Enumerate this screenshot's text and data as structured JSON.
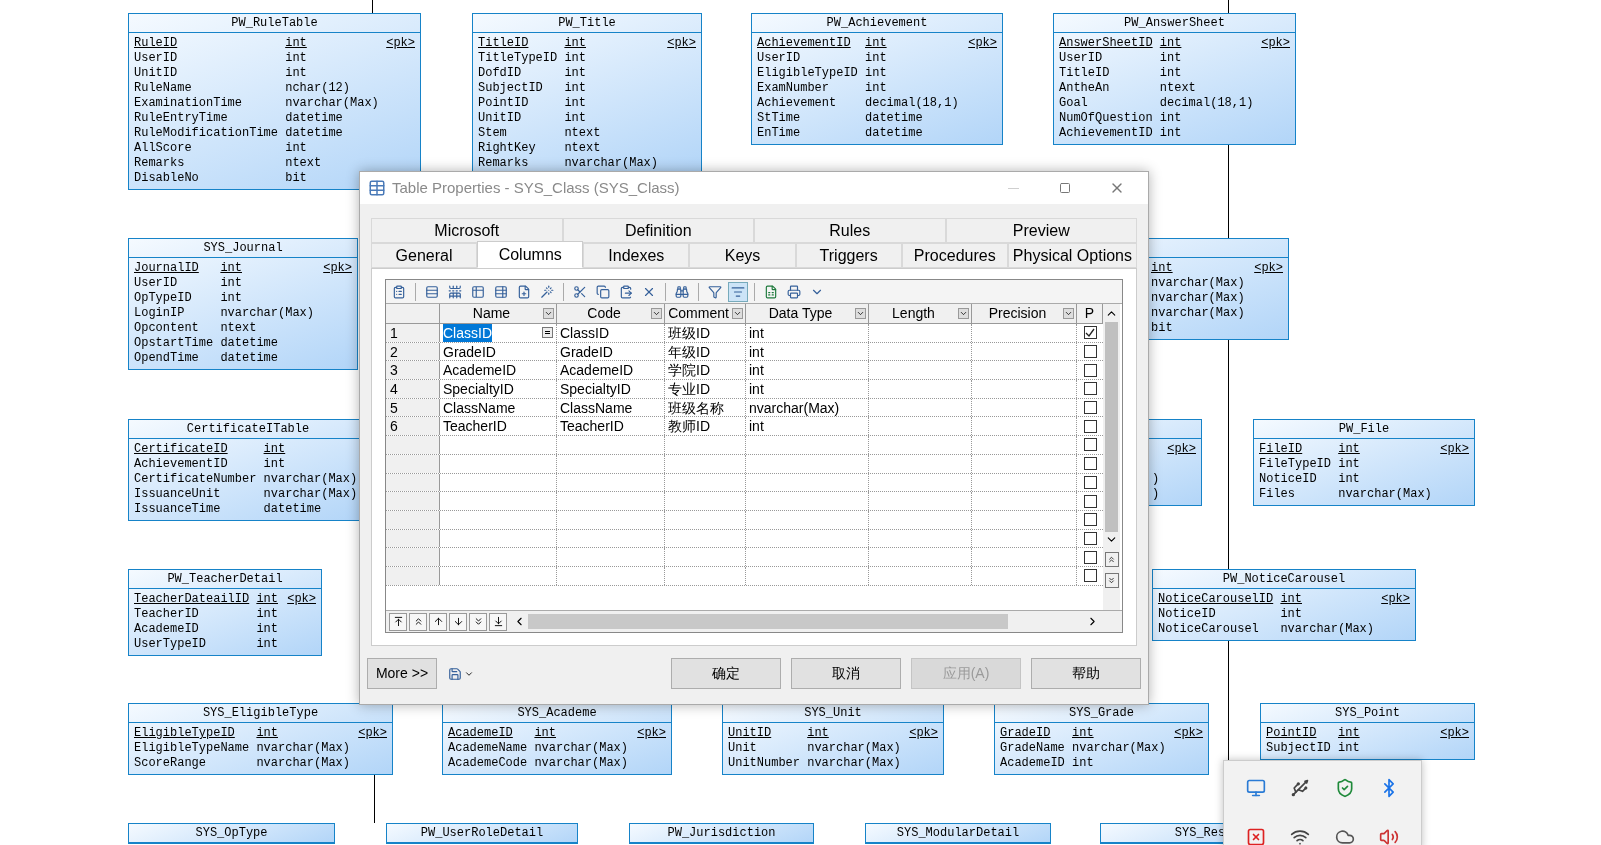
{
  "diagram": {
    "entities": [
      {
        "title": "PW_RuleTable",
        "columns": [
          {
            "name": "RuleID",
            "type": "int",
            "marker": "<pk>",
            "primary_key": true
          },
          {
            "name": "UserID",
            "type": "int",
            "primary_key": false
          },
          {
            "name": "UnitID",
            "type": "int",
            "primary_key": false
          },
          {
            "name": "RuleName",
            "type": "nchar(12)",
            "primary_key": false
          },
          {
            "name": "ExaminationTime",
            "type": "nvarchar(Max)",
            "primary_key": false
          },
          {
            "name": "RuleEntryTime",
            "type": "datetime",
            "primary_key": false
          },
          {
            "name": "RuleModificationTime",
            "type": "datetime",
            "primary_key": false
          },
          {
            "name": "AllScore",
            "type": "int",
            "primary_key": false
          },
          {
            "name": "Remarks",
            "type": "ntext",
            "primary_key": false
          },
          {
            "name": "DisableNo",
            "type": "bit",
            "primary_key": false
          }
        ]
      },
      {
        "title": "PW_Title",
        "columns": [
          {
            "name": "TitleID",
            "type": "int",
            "marker": "<pk>",
            "primary_key": true
          },
          {
            "name": "TitleTypeID",
            "type": "int",
            "primary_key": false
          },
          {
            "name": "DofdID",
            "type": "int",
            "primary_key": false
          },
          {
            "name": "SubjectID",
            "type": "int",
            "primary_key": false
          },
          {
            "name": "PointID",
            "type": "int",
            "primary_key": false
          },
          {
            "name": "UnitID",
            "type": "int",
            "primary_key": false
          },
          {
            "name": "Stem",
            "type": "ntext",
            "primary_key": false
          },
          {
            "name": "RightKey",
            "type": "ntext",
            "primary_key": false
          },
          {
            "name": "Remarks",
            "type": "nvarchar(Max)",
            "primary_key": false
          }
        ]
      },
      {
        "title": "PW_Achievement",
        "columns": [
          {
            "name": "AchievementID",
            "type": "int",
            "marker": "<pk>",
            "primary_key": true
          },
          {
            "name": "UserID",
            "type": "int",
            "primary_key": false
          },
          {
            "name": "EligibleTypeID",
            "type": "int",
            "primary_key": false
          },
          {
            "name": "ExamNumber",
            "type": "int",
            "primary_key": false
          },
          {
            "name": "Achievement",
            "type": "decimal(18,1)",
            "primary_key": false
          },
          {
            "name": "StTime",
            "type": "datetime",
            "primary_key": false
          },
          {
            "name": "EnTime",
            "type": "datetime",
            "primary_key": false
          }
        ]
      },
      {
        "title": "PW_AnswerSheet",
        "columns": [
          {
            "name": "AnswerSheetID",
            "type": "int",
            "marker": "<pk>",
            "primary_key": true
          },
          {
            "name": "UserID",
            "type": "int",
            "primary_key": false
          },
          {
            "name": "TitleID",
            "type": "int",
            "primary_key": false
          },
          {
            "name": "AntheAn",
            "type": "ntext",
            "primary_key": false
          },
          {
            "name": "Goal",
            "type": "decimal(18,1)",
            "primary_key": false
          },
          {
            "name": "NumOfQuestion",
            "type": "int",
            "primary_key": false
          },
          {
            "name": "AchievementID",
            "type": "int",
            "primary_key": false
          }
        ]
      },
      {
        "title": "SYS_Journal",
        "columns": [
          {
            "name": "JournalID",
            "type": "int",
            "marker": "<pk>",
            "primary_key": true
          },
          {
            "name": "UserID",
            "type": "int",
            "primary_key": false
          },
          {
            "name": "OpTypeID",
            "type": "int",
            "primary_key": false
          },
          {
            "name": "LoginIP",
            "type": "nvarchar(Max)",
            "primary_key": false
          },
          {
            "name": "Opcontent",
            "type": "ntext",
            "primary_key": false
          },
          {
            "name": "OpstartTime",
            "type": "datetime",
            "primary_key": false
          },
          {
            "name": "OpendTime",
            "type": "datetime",
            "primary_key": false
          }
        ]
      },
      {
        "columns": [
          {
            "type": "int",
            "marker": "<pk>",
            "primary_key": true
          },
          {
            "type": "nvarchar(Max)",
            "primary_key": false
          },
          {
            "type": "nvarchar(Max)",
            "primary_key": false
          },
          {
            "type": "nvarchar(Max)",
            "primary_key": false
          },
          {
            "type": "bit",
            "primary_key": false
          }
        ]
      },
      {
        "title": "CertificateITable",
        "columns": [
          {
            "name": "CertificateID",
            "type": "int",
            "primary_key": true
          },
          {
            "name": "AchievementID",
            "type": "int",
            "primary_key": false
          },
          {
            "name": "CertificateNumber",
            "type": "nvarchar(Max)",
            "primary_key": false
          },
          {
            "name": "IssuanceUnit",
            "type": "nvarchar(Max)",
            "primary_key": false
          },
          {
            "name": "IssuanceTime",
            "type": "datetime",
            "primary_key": false
          }
        ]
      },
      {
        "columns": [
          {
            "marker": "<pk>",
            "kind": "column"
          },
          {
            "type": ")",
            "kind": "spaced"
          },
          {
            "type": ")",
            "kind": "column"
          }
        ]
      },
      {
        "title": "PW_File",
        "columns": [
          {
            "name": "FileID",
            "type": "int",
            "marker": "<pk>",
            "primary_key": true
          },
          {
            "name": "FileTypeID",
            "type": "int",
            "primary_key": false
          },
          {
            "name": "NoticeID",
            "type": "int",
            "primary_key": false
          },
          {
            "name": "Files",
            "type": "nvarchar(Max)",
            "primary_key": false
          }
        ]
      },
      {
        "title": "PW_TeacherDetail",
        "columns": [
          {
            "name": "TeacherDateailID",
            "type": "int",
            "marker": "<pk>",
            "primary_key": true
          },
          {
            "name": "TeacherID",
            "type": "int",
            "primary_key": false
          },
          {
            "name": "AcademeID",
            "type": "int",
            "primary_key": false
          },
          {
            "name": "UserTypeID",
            "type": "int",
            "primary_key": false
          }
        ]
      },
      {
        "title": "PW_NoticeCarousel",
        "columns": [
          {
            "name": "NoticeCarouselID",
            "type": "int",
            "marker": "<pk>",
            "primary_key": true
          },
          {
            "name": "NoticeID",
            "type": "int",
            "primary_key": false
          },
          {
            "name": "NoticeCarousel",
            "type": "nvarchar(Max)",
            "primary_key": false
          }
        ]
      },
      {
        "title": "SYS_EligibleType",
        "columns": [
          {
            "name": "EligibleTypeID",
            "type": "int",
            "marker": "<pk>",
            "primary_key": true
          },
          {
            "name": "EligibleTypeName",
            "type": "nvarchar(Max)",
            "primary_key": false
          },
          {
            "name": "ScoreRange",
            "type": "nvarchar(Max)",
            "primary_key": false
          }
        ]
      },
      {
        "title": "SYS_Academe",
        "columns": [
          {
            "name": "AcademeID",
            "type": "int",
            "marker": "<pk>",
            "primary_key": true
          },
          {
            "name": "AcademeName",
            "type": "nvarchar(Max)",
            "primary_key": false
          },
          {
            "name": "AcademeCode",
            "type": "nvarchar(Max)",
            "primary_key": false
          }
        ]
      },
      {
        "title": "SYS_Unit",
        "columns": [
          {
            "name": "UnitID",
            "type": "int",
            "marker": "<pk>",
            "primary_key": true
          },
          {
            "name": "Unit",
            "type": "nvarchar(Max)",
            "primary_key": false
          },
          {
            "name": "UnitNumber",
            "type": "nvarchar(Max)",
            "primary_key": false
          }
        ]
      },
      {
        "title": "SYS_Grade",
        "columns": [
          {
            "name": "GradeID",
            "type": "int",
            "marker": "<pk>",
            "primary_key": true
          },
          {
            "name": "GradeName",
            "type": "nvarchar(Max)",
            "primary_key": false
          },
          {
            "name": "AcademeID",
            "type": "int",
            "primary_key": false
          }
        ]
      },
      {
        "title": "SYS_Point",
        "columns": [
          {
            "name": "PointID",
            "type": "int",
            "marker": "<pk>",
            "primary_key": true
          },
          {
            "name": "SubjectID",
            "type": "int",
            "primary_key": false
          }
        ]
      },
      {
        "title": "SYS_OpType"
      },
      {
        "title": "PW_UserRoleDetail"
      },
      {
        "title": "PW_Jurisdiction"
      },
      {
        "title": "SYS_ModularDetail"
      },
      {
        "title": "SYS_Res"
      }
    ]
  },
  "dialog": {
    "title": "Table Properties - SYS_Class (SYS_Class)",
    "tab_rows": [
      [
        {
          "label": "Microsoft",
          "selected": false
        },
        {
          "label": "Definition",
          "selected": false
        },
        {
          "label": "Rules",
          "selected": false
        },
        {
          "label": "Preview",
          "selected": false
        }
      ],
      [
        {
          "label": "General",
          "selected": false
        },
        {
          "label": "Columns",
          "selected": true
        },
        {
          "label": "Indexes",
          "selected": false
        },
        {
          "label": "Keys",
          "selected": false
        },
        {
          "label": "Triggers",
          "selected": false
        },
        {
          "label": "Procedures",
          "selected": false
        },
        {
          "label": "Physical Options",
          "selected": false
        }
      ]
    ],
    "toolbar": [
      {
        "kind": "properties",
        "pressed": false
      },
      {
        "kind": "separator"
      },
      {
        "kind": "insert-row",
        "pressed": false
      },
      {
        "kind": "add-row",
        "pressed": false
      },
      {
        "kind": "add-columns",
        "pressed": false
      },
      {
        "kind": "replicate",
        "pressed": false
      },
      {
        "kind": "new",
        "pressed": false
      },
      {
        "kind": "wand",
        "pressed": false
      },
      {
        "kind": "separator"
      },
      {
        "kind": "cut",
        "pressed": false
      },
      {
        "kind": "copy",
        "pressed": false
      },
      {
        "kind": "paste",
        "pressed": false
      },
      {
        "kind": "delete",
        "pressed": false
      },
      {
        "kind": "separator"
      },
      {
        "kind": "find",
        "pressed": false
      },
      {
        "kind": "separator"
      },
      {
        "kind": "filter",
        "pressed": false
      },
      {
        "kind": "filter-check",
        "pressed": true
      },
      {
        "kind": "separator"
      },
      {
        "kind": "excel",
        "pressed": false
      },
      {
        "kind": "print",
        "pressed": false
      },
      {
        "kind": "dropdown",
        "pressed": false
      }
    ],
    "grid": {
      "columns": [
        "Name",
        "Code",
        "Comment",
        "Data Type",
        "Length",
        "Precision",
        "P"
      ],
      "rows": [
        {
          "number": "1",
          "name": "ClassID",
          "code": "ClassID",
          "comment": "班级ID",
          "data_type": "int",
          "primary": true,
          "editing": true
        },
        {
          "number": "2",
          "name": "GradeID",
          "code": "GradeID",
          "comment": "年级ID",
          "data_type": "int",
          "primary": false,
          "editing": false
        },
        {
          "number": "3",
          "name": "AcademeID",
          "code": "AcademeID",
          "comment": "学院ID",
          "data_type": "int",
          "primary": false,
          "editing": false
        },
        {
          "number": "4",
          "name": "SpecialtyID",
          "code": "SpecialtyID",
          "comment": "专业ID",
          "data_type": "int",
          "primary": false,
          "editing": false
        },
        {
          "number": "5",
          "name": "ClassName",
          "code": "ClassName",
          "comment": "班级名称",
          "data_type": "nvarchar(Max)",
          "primary": false,
          "editing": false
        },
        {
          "number": "6",
          "name": "TeacherID",
          "code": "TeacherID",
          "comment": "教师ID",
          "data_type": "int",
          "primary": false,
          "editing": false
        },
        {
          "primary": false,
          "editing": false
        },
        {
          "primary": false,
          "editing": false
        },
        {
          "primary": false,
          "editing": false
        },
        {
          "primary": false,
          "editing": false
        },
        {
          "primary": false,
          "editing": false
        },
        {
          "primary": false,
          "editing": false
        },
        {
          "primary": false,
          "editing": false
        },
        {
          "primary": false,
          "editing": false
        }
      ]
    },
    "buttons": [
      {
        "label": "More >>",
        "kind": "more",
        "disabled": false
      },
      {
        "label": "确定",
        "kind": "action",
        "disabled": false
      },
      {
        "label": "取消",
        "kind": "action",
        "disabled": false
      },
      {
        "label": "应用(A)",
        "kind": "action",
        "disabled": true
      },
      {
        "label": "帮助",
        "kind": "action",
        "disabled": false
      }
    ]
  }
}
